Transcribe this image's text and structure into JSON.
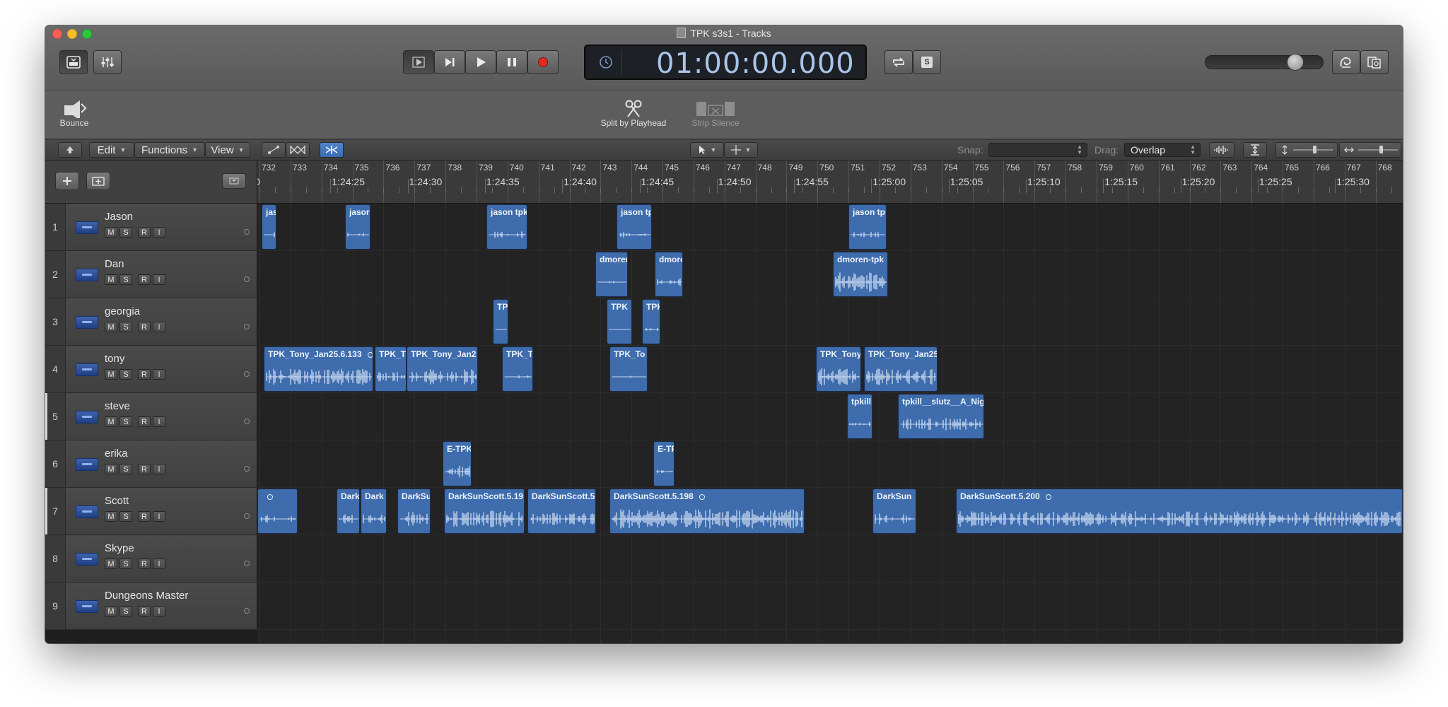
{
  "window": {
    "title": "TPK s3s1 - Tracks"
  },
  "control_bar": {
    "library_label": "Library",
    "mixer_label": "Mixer",
    "go_to_beginning_label": "Go to Beginning",
    "forward_label": "Forward",
    "play_label": "Play",
    "pause_label": "Pause",
    "record_label": "Record",
    "lcd_time": "01:00:00.000",
    "cycle_label": "Cycle",
    "solo_label": "S",
    "master_volume_level": 0.8
  },
  "toolbar": {
    "bounce_label": "Bounce",
    "split_label": "Split by Playhead",
    "strip_silence_label": "Strip Silence"
  },
  "local_menu": {
    "edit": "Edit",
    "functions": "Functions",
    "view": "View",
    "snap_label": "Snap:",
    "snap_value": "",
    "drag_label": "Drag:",
    "drag_value": "Overlap"
  },
  "ruler": {
    "bars": [
      "732",
      "733",
      "734",
      "735",
      "736",
      "737",
      "738",
      "739",
      "740",
      "741",
      "742",
      "743",
      "744",
      "745",
      "746",
      "747",
      "748",
      "749",
      "750",
      "751",
      "752",
      "753",
      "754",
      "755",
      "756",
      "757",
      "758",
      "759",
      "760",
      "761",
      "762",
      "763",
      "764",
      "765",
      "766",
      "767",
      "768"
    ],
    "times": [
      "0",
      "1:24:25",
      "1:24:30",
      "1:24:35",
      "1:24:40",
      "1:24:45",
      "1:24:50",
      "1:24:55",
      "1:25:00",
      "1:25:05",
      "1:25:10",
      "1:25:15",
      "1:25:20",
      "1:25:25",
      "1:25:30",
      "1:2"
    ]
  },
  "tracks": [
    {
      "num": "1",
      "name": "Jason",
      "selected": false
    },
    {
      "num": "2",
      "name": "Dan",
      "selected": false
    },
    {
      "num": "3",
      "name": "georgia",
      "selected": false
    },
    {
      "num": "4",
      "name": "tony",
      "selected": false
    },
    {
      "num": "5",
      "name": "steve",
      "selected": true
    },
    {
      "num": "6",
      "name": "erika",
      "selected": false
    },
    {
      "num": "7",
      "name": "Scott",
      "selected": true
    },
    {
      "num": "8",
      "name": "Skype",
      "selected": false
    },
    {
      "num": "9",
      "name": "Dungeons Master",
      "selected": false
    }
  ],
  "track_buttons": {
    "mute": "M",
    "solo": "S",
    "record": "R",
    "input": "I"
  },
  "regions": [
    {
      "track": 0,
      "name": "jas"
    },
    {
      "track": 0,
      "name": "jasor"
    },
    {
      "track": 0,
      "name": "jason tpk"
    },
    {
      "track": 0,
      "name": "jason tp"
    },
    {
      "track": 0,
      "name": "jason tp"
    },
    {
      "track": 1,
      "name": "dmoren"
    },
    {
      "track": 1,
      "name": "dmore"
    },
    {
      "track": 1,
      "name": "dmoren-tpk"
    },
    {
      "track": 2,
      "name": "TP"
    },
    {
      "track": 2,
      "name": "TPK"
    },
    {
      "track": 2,
      "name": "TPK"
    },
    {
      "track": 2,
      "name": ""
    },
    {
      "track": 3,
      "name": "TPK_Tony_Jan25.6.133"
    },
    {
      "track": 3,
      "name": "TPK_T"
    },
    {
      "track": 3,
      "name": "TPK_Tony_Jan2"
    },
    {
      "track": 3,
      "name": "TPK_T"
    },
    {
      "track": 3,
      "name": "TPK_To"
    },
    {
      "track": 3,
      "name": "TPK_Tony"
    },
    {
      "track": 3,
      "name": "TPK_Tony_Jan25"
    },
    {
      "track": 4,
      "name": "tpkill"
    },
    {
      "track": 4,
      "name": "tpkill__slutz__A_Nig"
    },
    {
      "track": 5,
      "name": "E-TPK"
    },
    {
      "track": 5,
      "name": "E-TP"
    },
    {
      "track": 6,
      "name": ""
    },
    {
      "track": 6,
      "name": "Dark"
    },
    {
      "track": 6,
      "name": "Dark"
    },
    {
      "track": 6,
      "name": "DarkSu"
    },
    {
      "track": 6,
      "name": "DarkSunScott.5.19"
    },
    {
      "track": 6,
      "name": "DarkSunScott.5"
    },
    {
      "track": 6,
      "name": "DarkSunScott.5.198"
    },
    {
      "track": 6,
      "name": "DarkSun"
    },
    {
      "track": 6,
      "name": "DarkSunScott.5.200"
    }
  ]
}
